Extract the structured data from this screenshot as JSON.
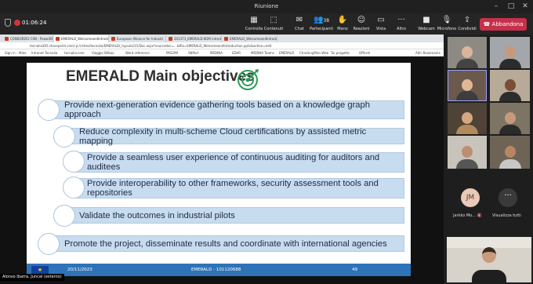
{
  "window": {
    "title": "Riunione"
  },
  "toolbar": {
    "timer": "01:06:24",
    "items": [
      {
        "label": "Controlla",
        "icon": "grid-icon"
      },
      {
        "label": "Contenuti",
        "icon": "share-icon"
      },
      {
        "label": "Chat",
        "icon": "chat-icon"
      },
      {
        "label": "Partecipanti",
        "icon": "people-icon",
        "count": "38"
      },
      {
        "label": "Mano",
        "icon": "hand-icon"
      },
      {
        "label": "Reazioni",
        "icon": "smile-icon"
      },
      {
        "label": "Vista",
        "icon": "view-icon"
      },
      {
        "label": "Altro",
        "icon": "more-icon"
      },
      {
        "label": "Webcam",
        "icon": "camera-icon"
      },
      {
        "label": "Microfono",
        "icon": "mic-icon"
      },
      {
        "label": "Condividi",
        "icon": "share-up-icon"
      }
    ],
    "leave_label": "Abbandona",
    "leave_color": "#c4314b"
  },
  "browser": {
    "tabs": [
      "CONSORZIO CINI - PowerBI",
      "EMERALD_WelcomeandIntrodu",
      "European Alliance for Industri",
      "201373_EMERALD-KOM introdu",
      "EMERALD_WelcomeandIntrodu"
    ],
    "url": "tecnalia365.sharepoint.com/:p:/r/sites/tecnalia/EMERALD/_layouts/15/Doc.aspx?sourcedoc=...&file=EMERALD_WelcomeandIntroduction.pptx&action=edit",
    "bookmarks": [
      "Sign in - Atlas",
      "Intranet Tecnalia",
      "tecnalia.com",
      "Viaggio Bilbao",
      "Word reference",
      "PAS299",
      "SNPort",
      "MEDINA",
      "EDAR",
      "MEDINA Teams",
      "EMERALD",
      "ChackingPlan Web",
      "Tui progetto",
      "Officeh",
      "Altri Bookmarks"
    ]
  },
  "slide": {
    "title": "EMERALD Main objectives",
    "objectives": [
      "Provide next-generation evidence gathering tools based on a knowledge graph approach",
      "Reduce complexity in multi-scheme Cloud certifications by assisted metric mapping",
      "Provide a seamless user experience of continuous auditing for auditors and auditees",
      "Provide interoperability to other frameworks, security assessment tools and repositories",
      "Validate the outcomes in industrial pilots",
      "Promote the project, disseminate results and coordinate with international agencies"
    ],
    "footer_date": "20/11/2023",
    "footer_project": "EMERALD - 101120688",
    "footer_page": "49",
    "accent": "#2e73b8"
  },
  "presenter_label": "Alonso Ibarra, Juncal (esterno)",
  "participants": {
    "avatar_initials": "JM",
    "avatar_name": "Jarkko Mo...",
    "more_label": "Visualizza tutti"
  }
}
